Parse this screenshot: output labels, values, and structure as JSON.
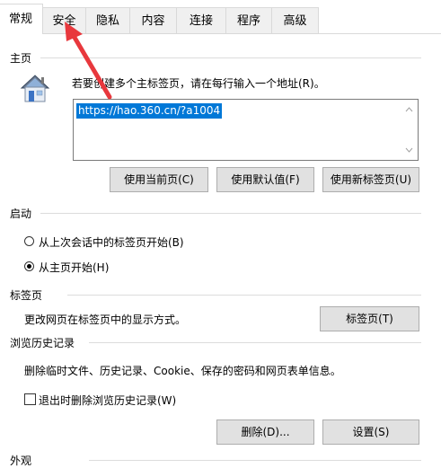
{
  "tabs": [
    {
      "label": "常规",
      "active": true
    },
    {
      "label": "安全"
    },
    {
      "label": "隐私"
    },
    {
      "label": "内容"
    },
    {
      "label": "连接"
    },
    {
      "label": "程序"
    },
    {
      "label": "高级"
    }
  ],
  "home": {
    "header": "主页",
    "description": "若要创建多个主标签页，请在每行输入一个地址(R)。",
    "url_value": "https://hao.360.cn/?a1004",
    "buttons": {
      "use_current": "使用当前页(C)",
      "use_default": "使用默认值(F)",
      "use_new_tab": "使用新标签页(U)"
    }
  },
  "startup": {
    "header": "启动",
    "option_last_session": "从上次会话中的标签页开始(B)",
    "option_home": "从主页开始(H)",
    "selected": "option_home"
  },
  "tabs_section": {
    "header": "标签页",
    "description": "更改网页在标签页中的显示方式。",
    "button": "标签页(T)"
  },
  "history": {
    "header": "浏览历史记录",
    "description": "删除临时文件、历史记录、Cookie、保存的密码和网页表单信息。",
    "checkbox_label": "退出时删除浏览历史记录(W)",
    "checked": false,
    "delete_button": "删除(D)...",
    "settings_button": "设置(S)"
  },
  "appearance": {
    "header": "外观"
  },
  "colors": {
    "accent_arrow": "#e8383d",
    "selection": "#0078d7"
  }
}
